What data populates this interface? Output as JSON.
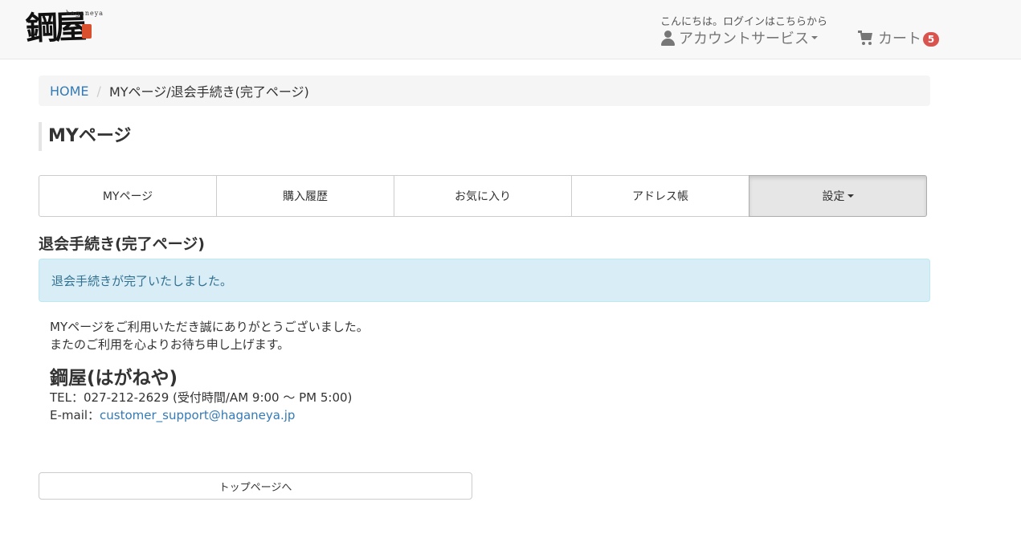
{
  "header": {
    "logo": {
      "text": "鋼屋",
      "romanized": "haganeya"
    },
    "greeting": "こんにちは。ログインはこちらから",
    "account_menu_label": "アカウントサービス",
    "cart_label": "カート",
    "cart_count": "5"
  },
  "breadcrumb": {
    "home": "HOME",
    "separator": "/",
    "current": "MYページ/退会手続き(完了ページ)"
  },
  "page_title": "MYページ",
  "tabs": [
    {
      "label": "MYページ"
    },
    {
      "label": "購入履歴"
    },
    {
      "label": "お気に入り"
    },
    {
      "label": "アドレス帳"
    },
    {
      "label": "設定",
      "active": true
    }
  ],
  "section": {
    "title": "退会手続き(完了ページ)",
    "alert": "退会手続きが完了いたしました。",
    "message_line1": "MYページをご利用いただき誠にありがとうございました。",
    "message_line2": "またのご利用を心よりお待ち申し上げます。",
    "company_name": "鋼屋(はがねや)",
    "tel": "TEL：027-212-2629 (受付時間/AM 9:00 ～ PM 5:00)",
    "email_label": "E-mail：",
    "email_address": "customer_support@haganeya.jp"
  },
  "top_page_button": "トップページへ",
  "colors": {
    "link": "#337ab7",
    "alert_bg": "#d9edf7",
    "alert_text": "#31708f",
    "badge": "#d9534f",
    "header_bg": "#f8f8f8"
  },
  "icons": {
    "account": "user-icon",
    "cart": "cart-icon",
    "dropdown": "caret-down-icon"
  }
}
